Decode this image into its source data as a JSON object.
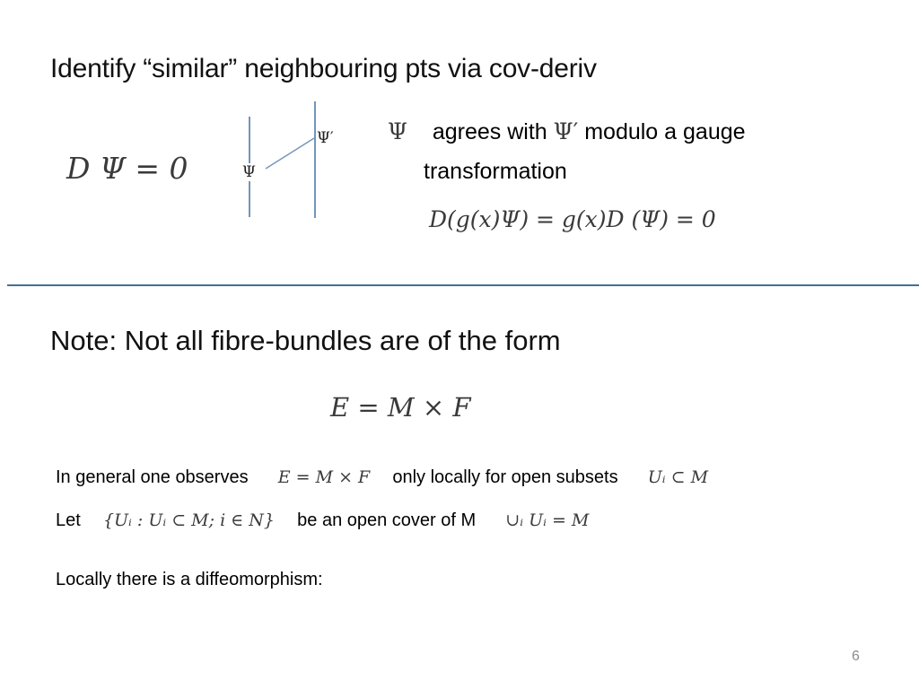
{
  "slide": {
    "title": "Identify “similar” neighbouring pts via cov-deriv",
    "page_number": "6",
    "divider_color": "#46708f",
    "diagram_line_color": "#7196bb",
    "math_color": "#3a3a3a"
  },
  "equations": {
    "cov_deriv": "D Ψ = 0",
    "gauge": "D(g(x)Ψ) = g(x)D (Ψ) = 0",
    "product_bundle": "E =  M × F"
  },
  "diagram": {
    "name": "fibre-diagram",
    "left_fibre_label": "Ψ",
    "right_fibre_label": "Ψ′"
  },
  "agrees": {
    "psi": "Ψ",
    "text_1": "agrees with",
    "psi_prime": "Ψ′",
    "text_2": "modulo a gauge",
    "text_3": "transformation"
  },
  "note": {
    "heading": "Note: Not all fibre-bundles are of the form"
  },
  "body": {
    "general_prefix": "In general one observes",
    "general_math": "E =  M × F",
    "general_suffix": "only locally for open subsets",
    "general_math_2": "Uᵢ ⊂ M",
    "let_prefix": "Let",
    "let_math": "{Uᵢ : Uᵢ ⊂ M; i ∈ N}",
    "let_suffix": "be an open cover of M",
    "let_math_2": "∪ᵢ Uᵢ = M",
    "locally": "Locally there is a diffeomorphism:"
  }
}
